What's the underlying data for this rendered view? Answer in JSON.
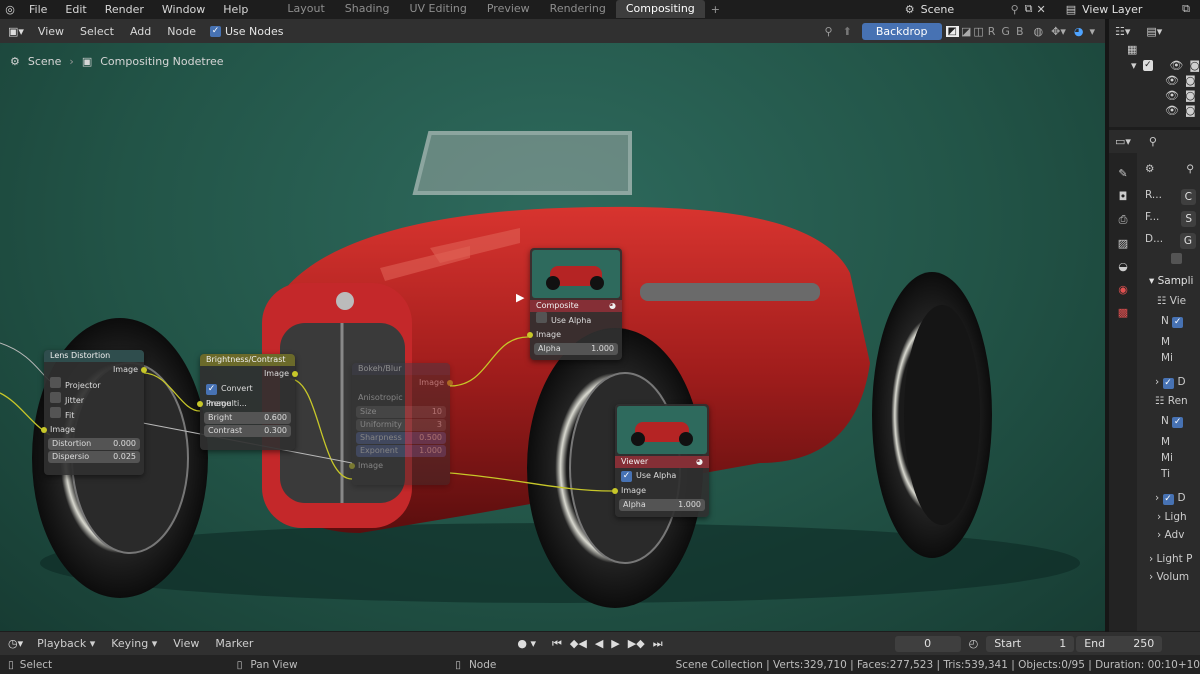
{
  "menu": [
    "File",
    "Edit",
    "Render",
    "Window",
    "Help"
  ],
  "workspaces": [
    "Layout",
    "Shading",
    "UV Editing",
    "Preview",
    "Rendering",
    "Compositing"
  ],
  "active_workspace": "Compositing",
  "scene_label": "Scene",
  "view_layer_label": "View Layer",
  "editor_menu": [
    "View",
    "Select",
    "Add",
    "Node"
  ],
  "use_nodes_label": "Use Nodes",
  "backdrop_label": "Backdrop",
  "channels": [
    "R",
    "G",
    "B"
  ],
  "breadcrumb": [
    "Scene",
    "Compositing Nodetree"
  ],
  "nodes": {
    "lens": {
      "title": "Lens Distortion",
      "image_out": "Image",
      "projector": "Projector",
      "jitter": "Jitter",
      "fit": "Fit",
      "image_in": "Image",
      "distortion_label": "Distortion",
      "distortion_value": "0.000",
      "dispersion_label": "Dispersio",
      "dispersion_value": "0.025"
    },
    "bc": {
      "title": "Brightness/Contrast",
      "image_out": "Image",
      "convert": "Convert Premulti...",
      "image_in": "Image",
      "bright_label": "Bright",
      "bright_value": "0.600",
      "contrast_label": "Contrast",
      "contrast_value": "0.300"
    },
    "mid": {
      "title": "Bokeh/Blur",
      "image_out": "Image",
      "anisotropic": "Anisotropic",
      "size_label": "Size",
      "size_value": "10",
      "uniform_label": "Uniformity",
      "uniform_value": "3",
      "sharp_label": "Sharpness",
      "sharp_value": "0.500",
      "exp_label": "Exponent",
      "exp_value": "1.000",
      "image_in": "Image"
    },
    "composite": {
      "title": "Composite",
      "use_alpha": "Use Alpha",
      "image": "Image",
      "alpha_label": "Alpha",
      "alpha_value": "1.000"
    },
    "viewer": {
      "title": "Viewer",
      "use_alpha": "Use Alpha",
      "image": "Image",
      "alpha_label": "Alpha",
      "alpha_value": "1.000"
    }
  },
  "props": {
    "fields": [
      {
        "label": "R...",
        "value": "C"
      },
      {
        "label": "F...",
        "value": "S"
      },
      {
        "label": "D...",
        "value": "G"
      }
    ],
    "sampling": "Sampli",
    "view": "Vie",
    "n1": "N",
    "m1": "M",
    "mi1": "Mi",
    "d1": "D",
    "ren": "Ren",
    "n2": "N",
    "m2": "M",
    "mi2": "Mi",
    "ti": "Ti",
    "d2": "D",
    "ligh": "Ligh",
    "adv": "Adv",
    "lightp": "Light P",
    "volum": "Volum"
  },
  "timeline": {
    "menu": [
      "Playback",
      "Keying",
      "View",
      "Marker"
    ],
    "current_frame": "0",
    "start_label": "Start",
    "start_value": "1",
    "end_label": "End",
    "end_value": "250"
  },
  "status": {
    "select": "Select",
    "pan": "Pan View",
    "node": "Node",
    "stats": "Scene Collection | Verts:329,710 | Faces:277,523 | Tris:539,341 | Objects:0/95 | Duration: 00:10+10"
  },
  "colors": {
    "accent": "#4772b3",
    "socket_yellow": "#c7c729",
    "node_header_red": "#852f36",
    "node_header_yellow": "#6b6a2a",
    "node_header_teal": "#2f4d4d"
  }
}
